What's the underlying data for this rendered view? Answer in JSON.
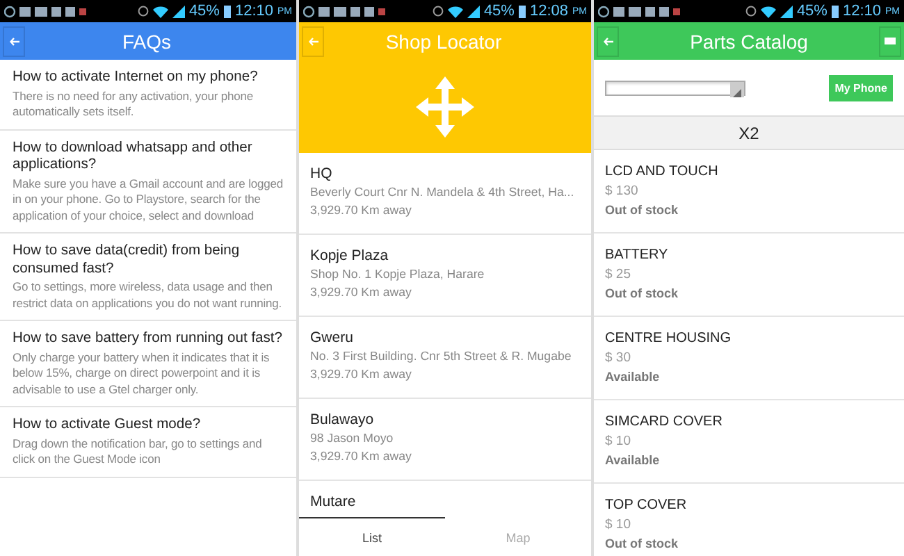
{
  "screens": [
    {
      "kind": "faq",
      "status_bar": {
        "battery": "45%",
        "time": "12:10",
        "ampm": "PM"
      },
      "title": "FAQs",
      "items": [
        {
          "question": "How to activate Internet on my phone?",
          "answer": "There is no need for any activation, your phone automatically sets itself."
        },
        {
          "question": "How to download whatsapp and other applications?",
          "answer": "Make sure you have a Gmail account and are logged in on your phone. Go to Playstore, search for the application of your choice, select and download"
        },
        {
          "question": "How to save data(credit) from being consumed fast?",
          "answer": "Go to settings, more wireless, data usage and then restrict data on applications you do not want running."
        },
        {
          "question": "How to save battery from running out fast?",
          "answer": "Only charge your battery when it indicates that it is below 15%, charge on direct powerpoint and it is advisable to use a Gtel charger only."
        },
        {
          "question": "How to activate Guest mode?",
          "answer": "Drag down the notification bar, go to settings and click on the Guest Mode icon"
        }
      ]
    },
    {
      "kind": "shop_locator",
      "status_bar": {
        "battery": "45%",
        "time": "12:08",
        "ampm": "PM"
      },
      "title": "Shop Locator",
      "shops": [
        {
          "name": "HQ",
          "address": "Beverly Court Cnr N. Mandela & 4th Street, Ha...",
          "distance": "3,929.70 Km away"
        },
        {
          "name": "Kopje Plaza",
          "address": "Shop No. 1 Kopje Plaza, Harare",
          "distance": "3,929.70 Km away"
        },
        {
          "name": "Gweru",
          "address": "No. 3 First Building. Cnr 5th Street & R. Mugabe",
          "distance": "3,929.70 Km away"
        },
        {
          "name": "Bulawayo",
          "address": "98 Jason Moyo",
          "distance": "3,929.70 Km away"
        },
        {
          "name": "Mutare"
        }
      ],
      "tabs": [
        {
          "label": "List",
          "selected": true
        },
        {
          "label": "Map",
          "selected": false
        }
      ]
    },
    {
      "kind": "parts_catalog",
      "status_bar": {
        "battery": "45%",
        "time": "12:10",
        "ampm": "PM"
      },
      "title": "Parts Catalog",
      "button": "My Phone",
      "model": "X2",
      "parts": [
        {
          "name": "LCD AND TOUCH",
          "price": "$ 130",
          "availability": "Out of stock"
        },
        {
          "name": "BATTERY",
          "price": "$ 25",
          "availability": "Out of stock"
        },
        {
          "name": "CENTRE HOUSING",
          "price": "$ 30",
          "availability": "Available"
        },
        {
          "name": "SIMCARD COVER",
          "price": "$ 10",
          "availability": "Available"
        },
        {
          "name": "TOP COVER",
          "price": "$ 10",
          "availability": "Out of stock"
        }
      ]
    }
  ]
}
